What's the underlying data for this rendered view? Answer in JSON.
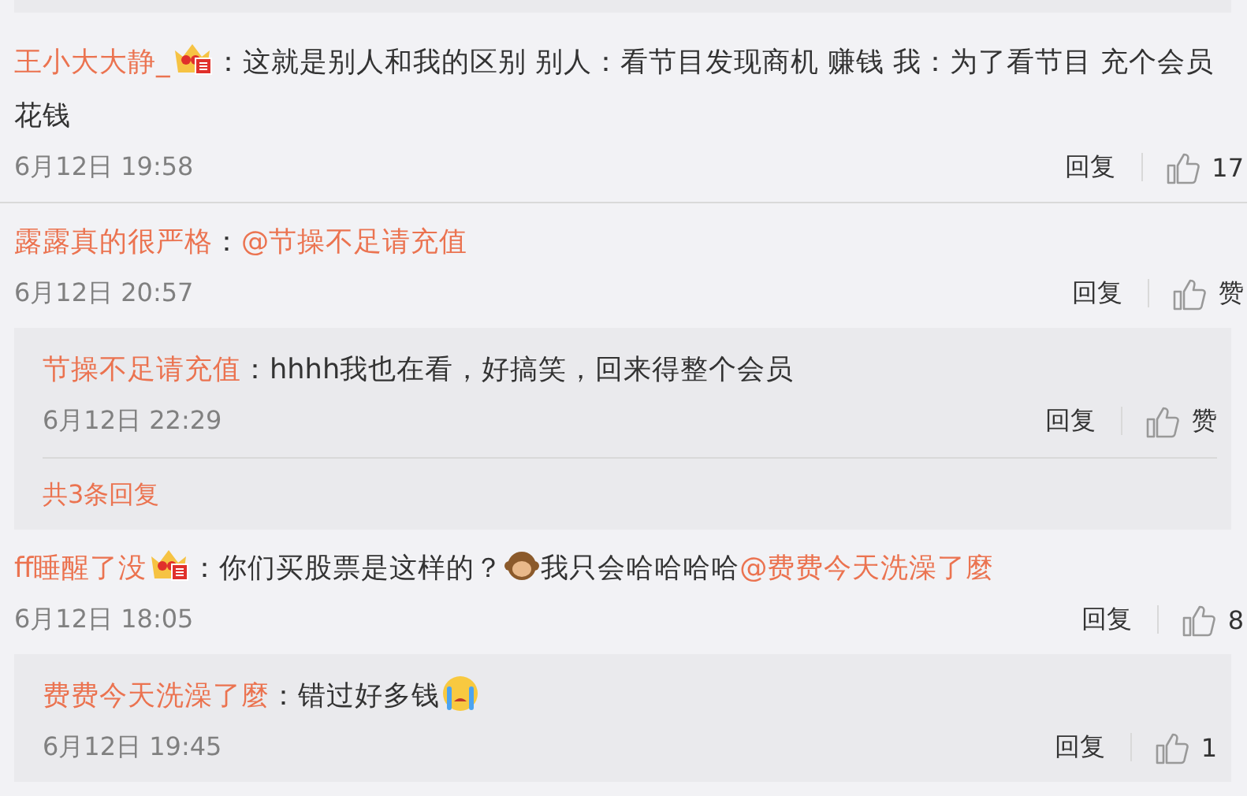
{
  "comments": [
    {
      "user": "王小大大静_",
      "vip_badge": true,
      "body": [
        {
          "kind": "text",
          "text": "：这就是别人和我的区别 别人：看节目发现商机  赚钱 我：为了看节目 充个会员"
        },
        {
          "kind": "text-line",
          "text": "花钱"
        }
      ],
      "time": "6月12日 19:58",
      "reply_label": "回复",
      "likes": "17"
    },
    {
      "user": "露露真的很严格",
      "vip_badge": false,
      "body": [
        {
          "kind": "text",
          "text": "："
        },
        {
          "kind": "mention",
          "text": "@节操不足请充值"
        }
      ],
      "time": "6月12日 20:57",
      "reply_label": "回复",
      "likes": "赞",
      "replies": [
        {
          "user": "节操不足请充值",
          "body": [
            {
              "kind": "text",
              "text": "：hhhh我也在看，好搞笑，回来得整个会员"
            }
          ],
          "time": "6月12日 22:29",
          "reply_label": "回复",
          "likes": "赞"
        }
      ],
      "more_replies": "共3条回复"
    },
    {
      "user": "ff睡醒了没",
      "vip_badge": true,
      "body": [
        {
          "kind": "text",
          "text": "：你们买股票是这样的？"
        },
        {
          "kind": "monkey-emoji"
        },
        {
          "kind": "text",
          "text": "我只会哈哈哈哈"
        },
        {
          "kind": "mention",
          "text": "@费费今天洗澡了麼"
        }
      ],
      "time": "6月12日 18:05",
      "reply_label": "回复",
      "likes": "8",
      "replies": [
        {
          "user": "费费今天洗澡了麼",
          "body": [
            {
              "kind": "text",
              "text": "：错过好多钱"
            },
            {
              "kind": "crying-emoji"
            }
          ],
          "time": "6月12日 19:45",
          "reply_label": "回复",
          "likes": "1"
        }
      ]
    }
  ]
}
